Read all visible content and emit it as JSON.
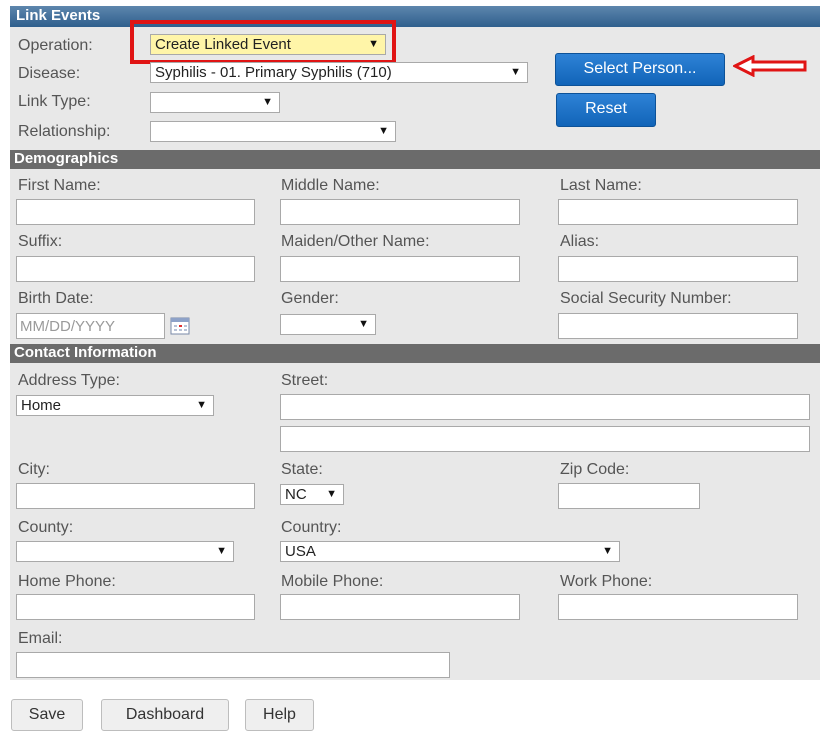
{
  "link_events": {
    "header": "Link Events",
    "operation_label": "Operation:",
    "operation_value": "Create Linked Event",
    "disease_label": "Disease:",
    "disease_value": "Syphilis - 01. Primary Syphilis (710)",
    "link_type_label": "Link Type:",
    "link_type_value": "",
    "relationship_label": "Relationship:",
    "relationship_value": "",
    "select_person_label": "Select Person...",
    "reset_label": "Reset",
    "highlight_color": "#e01414"
  },
  "demographics": {
    "header": "Demographics",
    "first_name_label": "First Name:",
    "middle_name_label": "Middle Name:",
    "last_name_label": "Last Name:",
    "suffix_label": "Suffix:",
    "maiden_label": "Maiden/Other Name:",
    "alias_label": "Alias:",
    "birth_date_label": "Birth Date:",
    "birth_date_placeholder": "MM/DD/YYYY",
    "gender_label": "Gender:",
    "gender_value": "",
    "ssn_label": "Social Security Number:"
  },
  "contact": {
    "header": "Contact Information",
    "address_type_label": "Address Type:",
    "address_type_value": "Home",
    "street_label": "Street:",
    "city_label": "City:",
    "state_label": "State:",
    "state_value": "NC",
    "zip_label": "Zip Code:",
    "county_label": "County:",
    "county_value": "",
    "country_label": "Country:",
    "country_value": "USA",
    "home_phone_label": "Home Phone:",
    "mobile_phone_label": "Mobile Phone:",
    "work_phone_label": "Work Phone:",
    "email_label": "Email:"
  },
  "footer": {
    "save_label": "Save",
    "dashboard_label": "Dashboard",
    "help_label": "Help"
  },
  "icons": {
    "calendar": "calendar-icon",
    "arrow": "left-arrow-icon",
    "dropdown": "chevron-down-icon"
  }
}
